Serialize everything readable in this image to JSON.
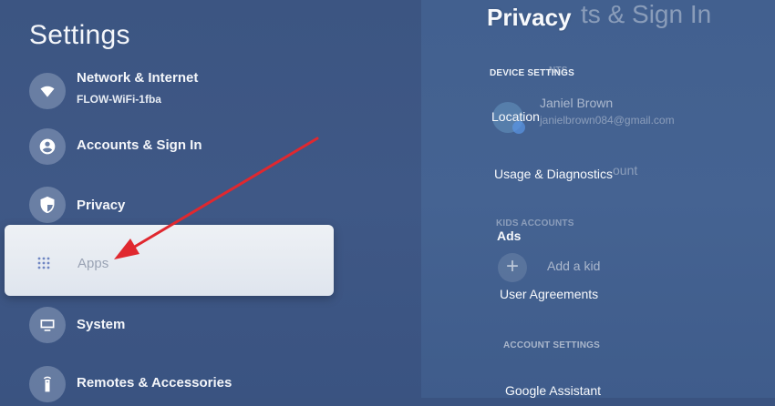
{
  "left": {
    "title": "Settings",
    "items": [
      {
        "label": "Network & Internet",
        "sub": "FLOW-WiFi-1fba"
      },
      {
        "label": "Accounts & Sign In"
      },
      {
        "label": "Privacy"
      },
      {
        "label": "Apps"
      },
      {
        "label": "System"
      },
      {
        "label": "Remotes & Accessories"
      }
    ]
  },
  "right_back": {
    "title": "ts & Sign In",
    "section_accounts": "NTS",
    "account_name": "Janiel Brown",
    "account_email": "janielbrown084@gmail.com",
    "add_account": "ount",
    "section_kids": "KIDS ACCOUNTS",
    "add_kid": "Add a kid",
    "section_account_settings": "ACCOUNT SETTINGS"
  },
  "right_front": {
    "title": "Privacy",
    "section_device": "DEVICE SETTINGS",
    "items": [
      "Location",
      "Usage & Diagnostics",
      "Ads",
      "User Agreements",
      "Google Assistant"
    ]
  },
  "colors": {
    "arrow": "#e0282f",
    "card": "#e8ecf2"
  }
}
